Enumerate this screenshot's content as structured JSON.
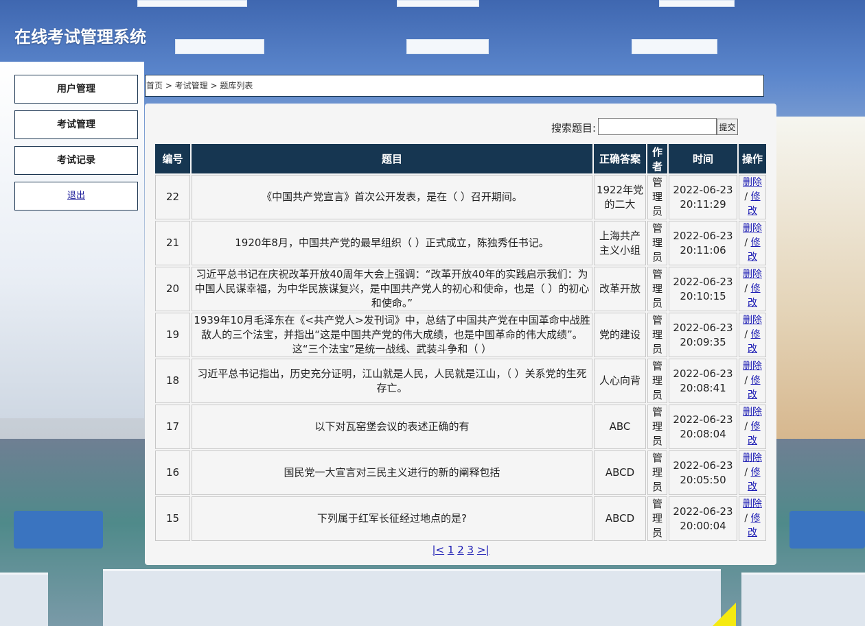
{
  "app": {
    "title": "在线考试管理系统"
  },
  "sidebar": {
    "items": [
      {
        "label": "用户管理"
      },
      {
        "label": "考试管理"
      },
      {
        "label": "考试记录"
      },
      {
        "label": "退出"
      }
    ]
  },
  "breadcrumb": {
    "text": "首页 > 考试管理 > 题库列表"
  },
  "search": {
    "label": "搜索题目:",
    "value": "",
    "placeholder": "",
    "submit_label": "提交"
  },
  "table": {
    "headers": [
      "编号",
      "题目",
      "正确答案",
      "作者",
      "时间",
      "操作"
    ],
    "rows": [
      {
        "id": "22",
        "question": "《中国共产党宣言》首次公开发表，是在（ ）召开期间。",
        "answer": "1922年党的二大",
        "author": "管理员",
        "date": "2022-06-23",
        "time": "20:11:29"
      },
      {
        "id": "21",
        "question": "1920年8月，中国共产党的最早组织（ ）正式成立，陈独秀任书记。",
        "answer": "上海共产主义小组",
        "author": "管理员",
        "date": "2022-06-23",
        "time": "20:11:06"
      },
      {
        "id": "20",
        "question": "习近平总书记在庆祝改革开放40周年大会上强调：“改革开放40年的实践启示我们：为中国人民谋幸福，为中华民族谋复兴，是中国共产党人的初心和使命，也是（ ）的初心和使命。”",
        "answer": "改革开放",
        "author": "管理员",
        "date": "2022-06-23",
        "time": "20:10:15"
      },
      {
        "id": "19",
        "question": "1939年10月毛泽东在《<共产党人>发刊词》中，总结了中国共产党在中国革命中战胜敌人的三个法宝，并指出“这是中国共产党的伟大成绩，也是中国革命的伟大成绩”。这“三个法宝”是统一战线、武装斗争和（ ）",
        "answer": "党的建设",
        "author": "管理员",
        "date": "2022-06-23",
        "time": "20:09:35"
      },
      {
        "id": "18",
        "question": "习近平总书记指出，历史充分证明，江山就是人民，人民就是江山，（ ）关系党的生死存亡。",
        "answer": "人心向背",
        "author": "管理员",
        "date": "2022-06-23",
        "time": "20:08:41"
      },
      {
        "id": "17",
        "question": "以下对瓦窑堡会议的表述正确的有",
        "answer": "ABC",
        "author": "管理员",
        "date": "2022-06-23",
        "time": "20:08:04"
      },
      {
        "id": "16",
        "question": "国民党一大宣言对三民主义进行的新的阐释包括",
        "answer": "ABCD",
        "author": "管理员",
        "date": "2022-06-23",
        "time": "20:05:50"
      },
      {
        "id": "15",
        "question": "下列属于红军长征经过地点的是?",
        "answer": "ABCD",
        "author": "管理员",
        "date": "2022-06-23",
        "time": "20:00:04"
      }
    ],
    "ops": {
      "delete": "删除",
      "sep": "/",
      "edit": "修改"
    }
  },
  "pager": {
    "first": "|<",
    "pages": [
      "1",
      "2",
      "3"
    ],
    "last": ">|"
  }
}
